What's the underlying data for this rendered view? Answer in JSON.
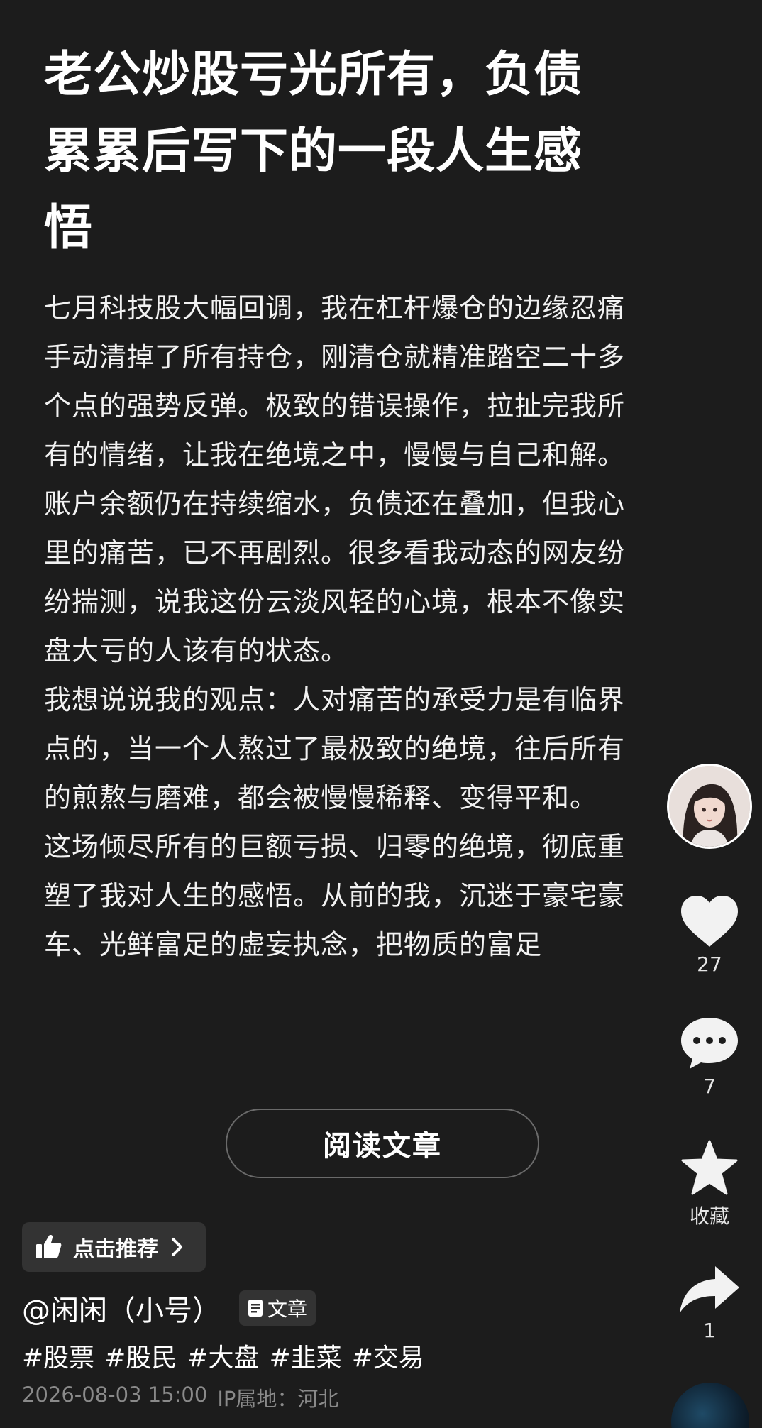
{
  "article": {
    "title": "老公炒股亏光所有，负债累累后写下的一段人生感悟",
    "paragraphs": [
      "七月科技股大幅回调，我在杠杆爆仓的边缘忍痛手动清掉了所有持仓，刚清仓就精准踏空二十多个点的强势反弹。极致的错误操作，拉扯完我所有的情绪，让我在绝境之中，慢慢与自己和解。",
      "账户余额仍在持续缩水，负债还在叠加，但我心里的痛苦，已不再剧烈。很多看我动态的网友纷纷揣测，说我这份云淡风轻的心境，根本不像实盘大亏的人该有的状态。",
      "我想说说我的观点：人对痛苦的承受力是有临界点的，当一个人熬过了最极致的绝境，往后所有的煎熬与磨难，都会被慢慢稀释、变得平和。",
      "这场倾尽所有的巨额亏损、归零的绝境，彻底重塑了我对人生的感悟。从前的我，沉迷于豪宅豪车、光鲜富足的虚妄执念，把物质的富足"
    ],
    "read_button": "阅读文章"
  },
  "recommend": {
    "label": "点击推荐"
  },
  "author": {
    "name": "@闲闲（小号）",
    "type_badge": "文章"
  },
  "tags": [
    "#股票",
    "#股民",
    "#大盘",
    "#韭菜",
    "#交易"
  ],
  "meta": {
    "datetime": "2026-08-03 15:00",
    "ip_location": "IP属地：河北"
  },
  "actions": {
    "like_count": "27",
    "comment_count": "7",
    "favorite_label": "收藏",
    "share_count": "1"
  },
  "colors": {
    "background": "#1c1c1c",
    "text": "#ffffff",
    "muted": "#8a8a8a",
    "chip": "#333333"
  }
}
